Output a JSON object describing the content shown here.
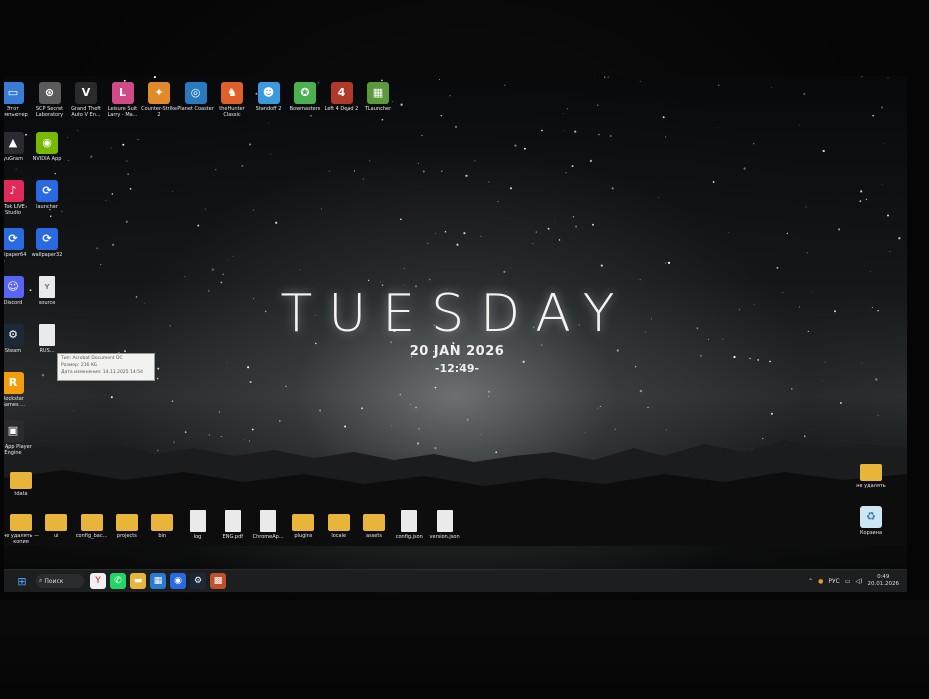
{
  "desktop": {
    "day": "TUESDAY",
    "date": "20 JAN 2026",
    "time": "-12:49-"
  },
  "icons_top": [
    {
      "label": "Этот компьютер",
      "color": "#3a7bd5",
      "glyph": "▭"
    },
    {
      "label": "SCP Secret Laboratory",
      "color": "#5a5a5a",
      "glyph": "⊛"
    },
    {
      "label": "Grand Theft Auto V En...",
      "color": "#2a2a2a",
      "glyph": "V"
    },
    {
      "label": "Leisure Suit Larry - Ma...",
      "color": "#d04a8a",
      "glyph": "L"
    },
    {
      "label": "Counter-Strike 2",
      "color": "#e08a2a",
      "glyph": "✦"
    },
    {
      "label": "Planet Coaster",
      "color": "#2a7ac0",
      "glyph": "◎"
    },
    {
      "label": "theHunter Classic",
      "color": "#e0602a",
      "glyph": "♞"
    },
    {
      "label": "Standoff 2",
      "color": "#3a9ae0",
      "glyph": "☻"
    },
    {
      "label": "Bowmasters",
      "color": "#4ab050",
      "glyph": "✪"
    },
    {
      "label": "Left 4 Dead 2",
      "color": "#b03a2a",
      "glyph": "4"
    },
    {
      "label": "TLauncher",
      "color": "#5a9a3a",
      "glyph": "▦"
    }
  ],
  "icons_left": [
    {
      "label": "yuGram",
      "color": "#2a2a30",
      "glyph": "▲"
    },
    {
      "label": "NVIDIA App",
      "color": "#76b900",
      "glyph": "◉"
    },
    {
      "label": "kTok LIVE Studio",
      "color": "#e02a5a",
      "glyph": "♪"
    },
    {
      "label": "launcher",
      "color": "#2a6ae0",
      "glyph": "⟳"
    },
    {
      "label": "allpaper64",
      "color": "#2a6ae0",
      "glyph": "⟳"
    },
    {
      "label": "wallpaper32",
      "color": "#2a6ae0",
      "glyph": "⟳"
    },
    {
      "label": "Discord",
      "color": "#5865f2",
      "glyph": "☺"
    },
    {
      "label": "source",
      "color": "#eaeaea",
      "glyph": "Y"
    },
    {
      "label": "Steam",
      "color": "#1b2838",
      "glyph": "⚙"
    },
    {
      "label": "RUS...",
      "color": "#eaeaea",
      "glyph": ""
    },
    {
      "label": "Rockstar Games ...",
      "color": "#f29e0c",
      "glyph": "R"
    },
    {
      "label": "MSI App Player Engine",
      "color": "#2a2a30",
      "glyph": "▣"
    },
    {
      "label": "tdata",
      "color": "#e8b53a",
      "glyph": ""
    }
  ],
  "icons_bottom": [
    {
      "label": "не удалять — копия",
      "type": "folder"
    },
    {
      "label": "ui",
      "type": "folder"
    },
    {
      "label": "config_bac...",
      "type": "folder"
    },
    {
      "label": "projects",
      "type": "folder"
    },
    {
      "label": "bin",
      "type": "folder"
    },
    {
      "label": "log",
      "type": "doc"
    },
    {
      "label": "ENG.pdf",
      "type": "doc"
    },
    {
      "label": "ChromeAp...",
      "type": "doc"
    },
    {
      "label": "plugins",
      "type": "folder"
    },
    {
      "label": "locale",
      "type": "folder"
    },
    {
      "label": "assets",
      "type": "folder"
    },
    {
      "label": "config.json",
      "type": "doc"
    },
    {
      "label": "version.json",
      "type": "doc"
    }
  ],
  "icons_right": [
    {
      "label": "не удалять",
      "type": "folder"
    },
    {
      "label": "Корзина",
      "type": "bin"
    }
  ],
  "tooltip": {
    "line1": "Тип: Acrobat Document DC",
    "line2": "Размер: 216 КБ",
    "line3": "Дата изменения: 14.11.2025 14:54"
  },
  "taskbar": {
    "search_label": "Поиск",
    "apps": [
      {
        "name": "yandex-browser",
        "color": "#f0f0f0",
        "glyph": "Y"
      },
      {
        "name": "whatsapp",
        "color": "#25d366",
        "glyph": "✆"
      },
      {
        "name": "file-explorer",
        "color": "#e8b53a",
        "glyph": "▬"
      },
      {
        "name": "microsoft-store",
        "color": "#2a7ad0",
        "glyph": "▦"
      },
      {
        "name": "app-blue",
        "color": "#2a6ae0",
        "glyph": "◉"
      },
      {
        "name": "steam",
        "color": "#1b2838",
        "glyph": "⚙"
      },
      {
        "name": "app-multicolor",
        "color": "#c0502a",
        "glyph": "▩"
      }
    ],
    "tray_lang": "РУС",
    "clock_time": "0:49",
    "clock_date": "20.01.2026"
  }
}
